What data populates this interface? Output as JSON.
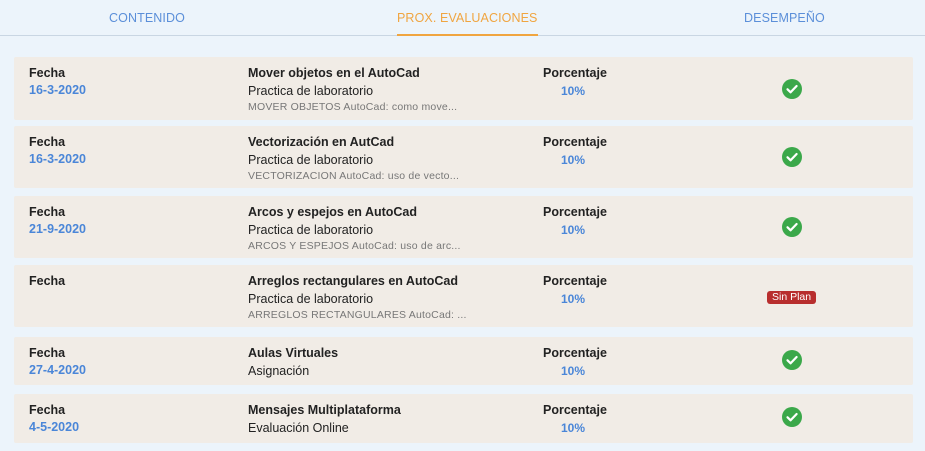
{
  "tabs": [
    {
      "label": "CONTENIDO",
      "active": false
    },
    {
      "label": "PROX. EVALUACIONES",
      "active": true
    },
    {
      "label": "DESEMPEÑO",
      "active": false
    }
  ],
  "colors": {
    "accent": "#f0a540",
    "link": "#5b8fd9",
    "check": "#3ba84a",
    "badge": "#b82e2e",
    "card": "#f1ece6"
  },
  "evaluations": [
    {
      "fecha_label": "Fecha",
      "fecha": "16-3-2020",
      "title": "Mover objetos en el AutoCad",
      "type": "Practica de laboratorio",
      "description": "MOVER OBJETOS AutoCad: como move...",
      "porcentaje_label": "Porcentaje",
      "porcentaje": "10%",
      "status_icon": "check-circle-icon"
    },
    {
      "fecha_label": "Fecha",
      "fecha": "16-3-2020",
      "title": "Vectorización en AutCad",
      "type": "Practica de laboratorio",
      "description": "VECTORIZACION AutoCad: uso de vecto...",
      "porcentaje_label": "Porcentaje",
      "porcentaje": "10%",
      "status_icon": "check-circle-icon"
    },
    {
      "fecha_label": "Fecha",
      "fecha": "21-9-2020",
      "title": "Arcos y espejos en AutoCad",
      "type": "Practica de laboratorio",
      "description": "ARCOS Y ESPEJOS AutoCad: uso de arc...",
      "porcentaje_label": "Porcentaje",
      "porcentaje": "10%",
      "status_icon": "check-circle-icon"
    },
    {
      "fecha_label": "Fecha",
      "fecha": "",
      "title": "Arreglos rectangulares en AutoCad",
      "type": "Practica de laboratorio",
      "description": "ARREGLOS RECTANGULARES AutoCad: ...",
      "porcentaje_label": "Porcentaje",
      "porcentaje": "10%",
      "status_badge": "Sin Plan"
    },
    {
      "fecha_label": "Fecha",
      "fecha": "27-4-2020",
      "title": "Aulas Virtuales",
      "type": "Asignación",
      "description": "",
      "porcentaje_label": "Porcentaje",
      "porcentaje": "10%",
      "status_icon": "check-circle-icon"
    },
    {
      "fecha_label": "Fecha",
      "fecha": "4-5-2020",
      "title": "Mensajes Multiplataforma",
      "type": "Evaluación Online",
      "description": "",
      "porcentaje_label": "Porcentaje",
      "porcentaje": "10%",
      "status_icon": "check-circle-icon"
    }
  ]
}
